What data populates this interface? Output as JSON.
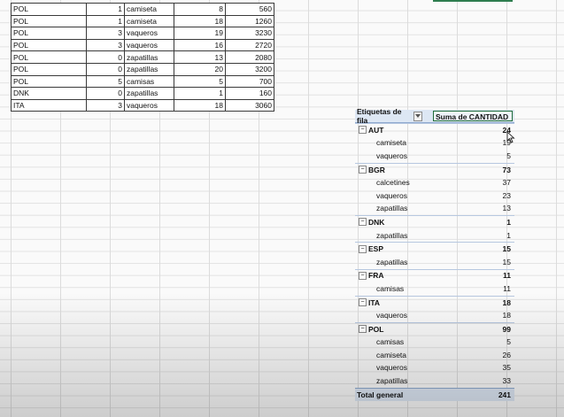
{
  "data_rows": [
    {
      "country": "POL",
      "color": "1",
      "product": "camiseta",
      "qty": "8",
      "total": "560"
    },
    {
      "country": "POL",
      "color": "1",
      "product": "camiseta",
      "qty": "18",
      "total": "1260"
    },
    {
      "country": "POL",
      "color": "3",
      "product": "vaqueros",
      "qty": "19",
      "total": "3230"
    },
    {
      "country": "POL",
      "color": "3",
      "product": "vaqueros",
      "qty": "16",
      "total": "2720"
    },
    {
      "country": "POL",
      "color": "0",
      "product": "zapatillas",
      "qty": "13",
      "total": "2080"
    },
    {
      "country": "POL",
      "color": "0",
      "product": "zapatillas",
      "qty": "20",
      "total": "3200"
    },
    {
      "country": "POL",
      "color": "5",
      "product": "camisas",
      "qty": "5",
      "total": "700"
    },
    {
      "country": "DNK",
      "color": "0",
      "product": "zapatillas",
      "qty": "1",
      "total": "160"
    },
    {
      "country": "ITA",
      "color": "3",
      "product": "vaqueros",
      "qty": "18",
      "total": "3060"
    }
  ],
  "pivot": {
    "row_label_header": "Etiquetas de fila",
    "value_header": "Suma de CANTIDAD",
    "groups": [
      {
        "name": "AUT",
        "total": "24",
        "items": [
          {
            "name": "camiseta",
            "value": "19"
          },
          {
            "name": "vaqueros",
            "value": "5"
          }
        ]
      },
      {
        "name": "BGR",
        "total": "73",
        "items": [
          {
            "name": "calcetines",
            "value": "37"
          },
          {
            "name": "vaqueros",
            "value": "23"
          },
          {
            "name": "zapatillas",
            "value": "13"
          }
        ]
      },
      {
        "name": "DNK",
        "total": "1",
        "items": [
          {
            "name": "zapatillas",
            "value": "1"
          }
        ]
      },
      {
        "name": "ESP",
        "total": "15",
        "items": [
          {
            "name": "zapatillas",
            "value": "15"
          }
        ]
      },
      {
        "name": "FRA",
        "total": "11",
        "items": [
          {
            "name": "camisas",
            "value": "11"
          }
        ]
      },
      {
        "name": "ITA",
        "total": "18",
        "items": [
          {
            "name": "vaqueros",
            "value": "18"
          }
        ]
      },
      {
        "name": "POL",
        "total": "99",
        "items": [
          {
            "name": "camisas",
            "value": "5"
          },
          {
            "name": "camiseta",
            "value": "26"
          },
          {
            "name": "vaqueros",
            "value": "35"
          },
          {
            "name": "zapatillas",
            "value": "33"
          }
        ]
      }
    ],
    "grand_total_label": "Total general",
    "grand_total_value": "241",
    "collapse_symbol": "−"
  },
  "colors": {
    "accent": "#2e7d4f",
    "pivot_header_bg": "#dde7f4",
    "grid": "#dcdcdc"
  },
  "icons": {
    "filter": "filter-dropdown-icon",
    "collapse": "collapse-minus-icon",
    "cursor": "move-cursor-icon"
  }
}
